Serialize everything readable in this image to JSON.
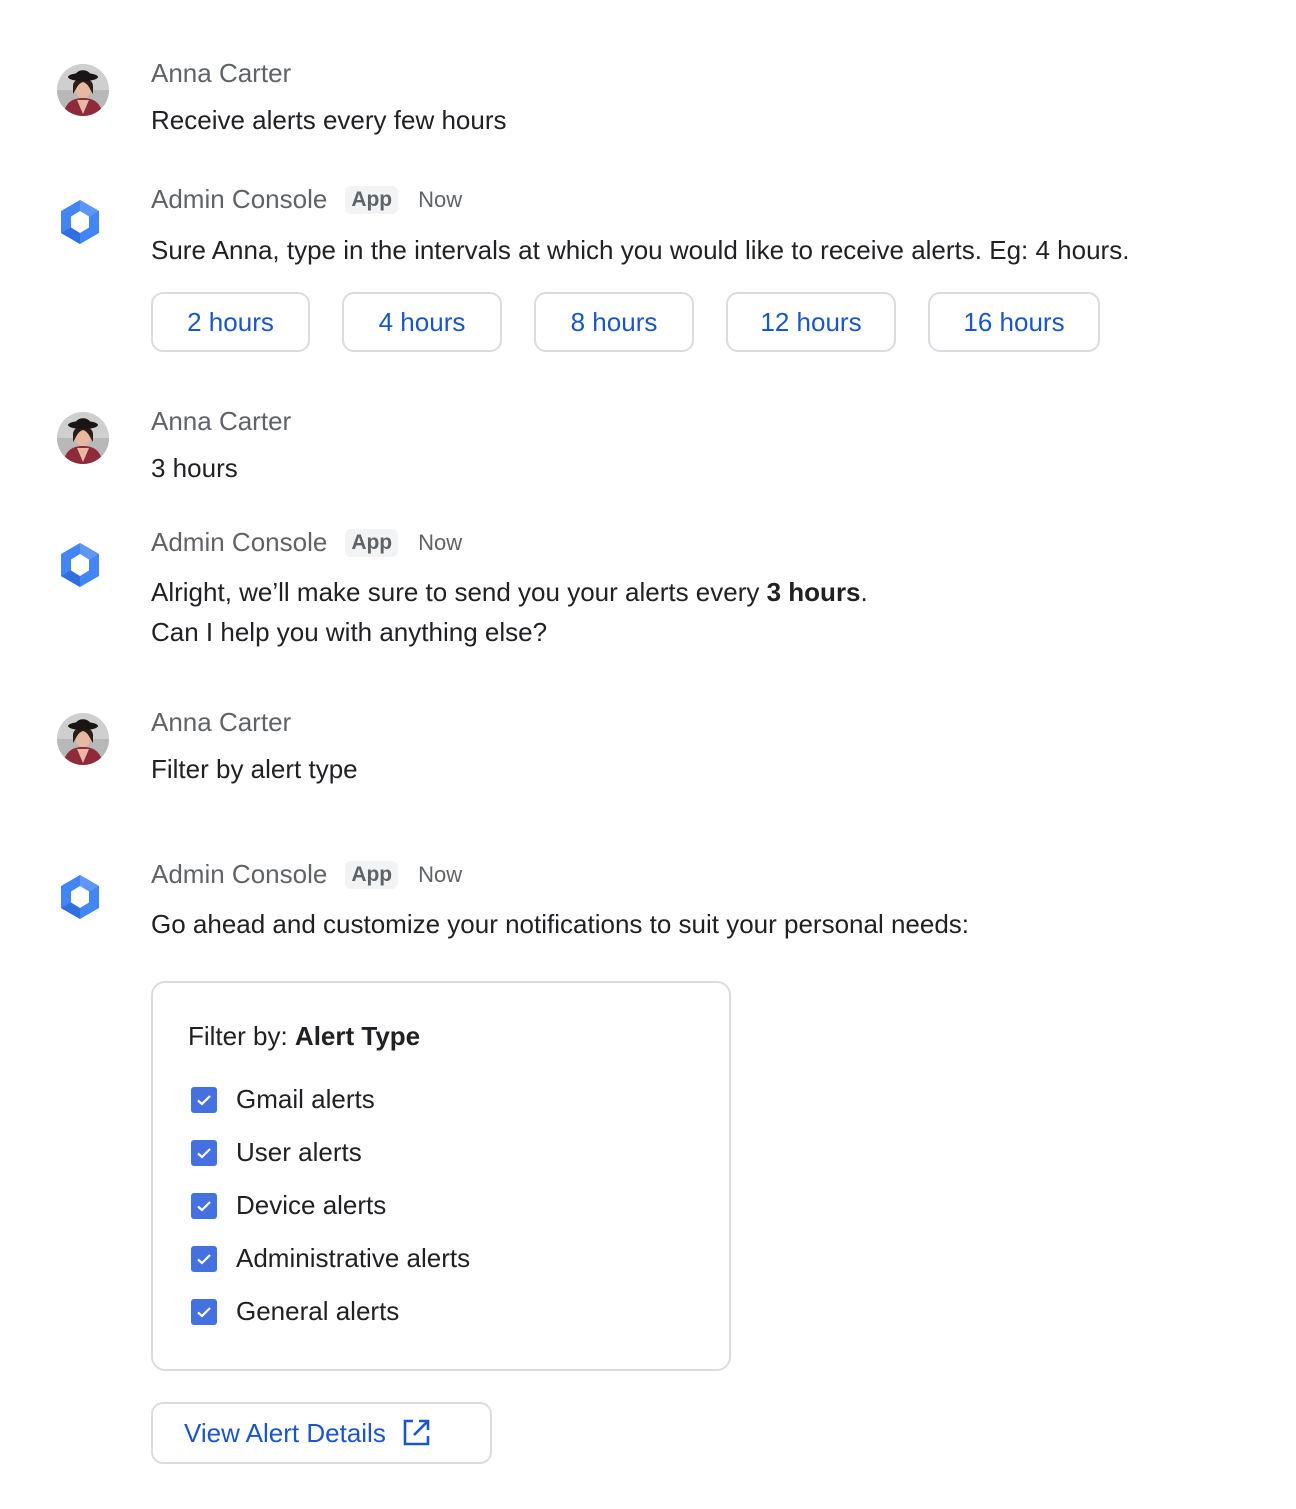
{
  "messages": [
    {
      "sender": "Anna Carter",
      "text": "Receive alerts every few hours"
    },
    {
      "sender": "Admin Console",
      "badge": "App",
      "time": "Now",
      "text": "Sure Anna, type in the intervals at which you would like to receive alerts. Eg: 4 hours.",
      "chips": [
        "2 hours",
        "4 hours",
        "8 hours",
        "12 hours",
        "16 hours"
      ]
    },
    {
      "sender": "Anna Carter",
      "text": "3 hours"
    },
    {
      "sender": "Admin Console",
      "badge": "App",
      "time": "Now",
      "text_pre": "Alright, we’ll make sure to send you your alerts every ",
      "text_bold": "3 hours",
      "text_post": ".",
      "text_line2": "Can I help you with anything else?"
    },
    {
      "sender": "Anna Carter",
      "text": "Filter by alert type"
    },
    {
      "sender": "Admin Console",
      "badge": "App",
      "time": "Now",
      "text": "Go ahead and customize your notifications to suit your personal needs:"
    }
  ],
  "filter_card": {
    "label": "Filter by:",
    "value": "Alert Type",
    "options": [
      {
        "label": "Gmail alerts",
        "checked": true
      },
      {
        "label": "User alerts",
        "checked": true
      },
      {
        "label": "Device alerts",
        "checked": true
      },
      {
        "label": "Administrative alerts",
        "checked": true
      },
      {
        "label": "General alerts",
        "checked": true
      }
    ]
  },
  "details_button": {
    "label": "View Alert Details",
    "icon": "open-in-new-icon"
  },
  "colors": {
    "accent": "#1a56c8",
    "checkbox": "#4470e0",
    "app_icon": "#4285f4"
  }
}
